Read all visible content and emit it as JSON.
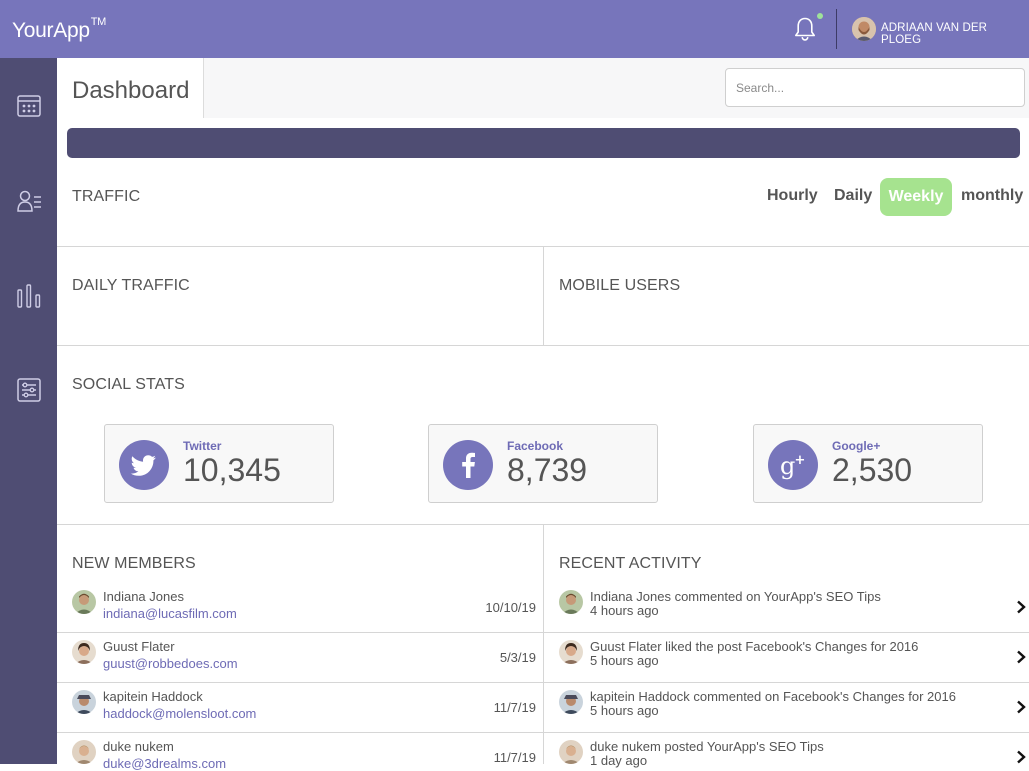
{
  "app": {
    "brand": "YourApp",
    "trademark": "TM",
    "user_name": "ADRIAAN VAN DER PLOEG"
  },
  "colors": {
    "topbar": "#7775bb",
    "sidebar": "#4f4d73",
    "accent": "#6e6bb5",
    "active_pill": "#a6e38f",
    "notification_dot": "#9fe29a"
  },
  "sidebar": {
    "items": [
      {
        "icon": "calendar-icon"
      },
      {
        "icon": "user-list-icon"
      },
      {
        "icon": "bar-chart-icon"
      },
      {
        "icon": "settings-sliders-icon"
      }
    ]
  },
  "header": {
    "title": "Dashboard",
    "search_placeholder": "Search..."
  },
  "traffic": {
    "title": "TRAFFIC",
    "periods": [
      "Hourly",
      "Daily",
      "Weekly",
      "monthly"
    ],
    "active_period": "Weekly"
  },
  "daily_traffic": {
    "title": "DAILY TRAFFIC"
  },
  "mobile_users": {
    "title": "MOBILE USERS"
  },
  "social": {
    "title": "SOCIAL STATS",
    "cards": [
      {
        "name": "Twitter",
        "value": "10,345",
        "icon": "twitter-icon"
      },
      {
        "name": "Facebook",
        "value": "8,739",
        "icon": "facebook-icon"
      },
      {
        "name": "Google+",
        "value": "2,530",
        "icon": "google-plus-icon"
      }
    ]
  },
  "new_members": {
    "title": "NEW MEMBERS",
    "rows": [
      {
        "name": "Indiana Jones",
        "email": "indiana@lucasfilm.com",
        "date": "10/10/19"
      },
      {
        "name": "Guust Flater",
        "email": "guust@robbedoes.com",
        "date": "5/3/19"
      },
      {
        "name": "kapitein Haddock",
        "email": "haddock@molensloot.com",
        "date": "11/7/19"
      },
      {
        "name": "duke nukem",
        "email": "duke@3drealms.com",
        "date": "11/7/19"
      }
    ]
  },
  "recent_activity": {
    "title": "RECENT ACTIVITY",
    "rows": [
      {
        "text": "Indiana Jones commented on YourApp's SEO Tips",
        "time": "4 hours ago"
      },
      {
        "text": "Guust Flater liked the post Facebook's Changes for 2016",
        "time": "5 hours ago"
      },
      {
        "text": "kapitein Haddock commented on Facebook's Changes for 2016",
        "time": "5 hours ago"
      },
      {
        "text": "duke nukem posted YourApp's SEO Tips",
        "time": "1 day ago"
      }
    ]
  }
}
